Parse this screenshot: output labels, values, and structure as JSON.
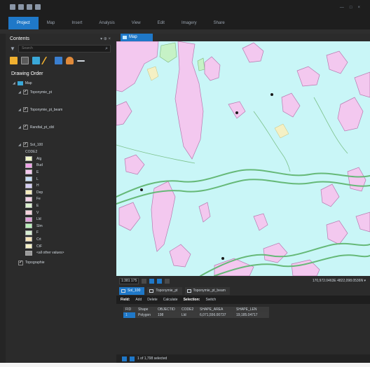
{
  "ribbon": {
    "tabs": [
      "Project",
      "Map",
      "Insert",
      "Analysis",
      "View",
      "Edit",
      "Imagery",
      "Share"
    ],
    "active_tab": "Project"
  },
  "contents": {
    "title": "Contents",
    "pane_controls": "▾ ⊕ ×",
    "search_placeholder": "Search",
    "drawing_order_label": "Drawing Order",
    "map_name": "Map",
    "layers": [
      {
        "name": "Toponymie_pt",
        "checked": true
      },
      {
        "name": "Toponymie_pt_beam",
        "checked": true
      },
      {
        "name": "Randtal_pt_cibl",
        "checked": true
      },
      {
        "name": "Sol_100",
        "checked": true
      }
    ],
    "legend_field": "CODE2",
    "legend": [
      {
        "label": "Alg",
        "color": "#f1f7c9"
      },
      {
        "label": "Bud",
        "color": "#f0a0e8"
      },
      {
        "label": "E",
        "color": "#f4c7ee"
      },
      {
        "label": "L",
        "color": "#c5def7"
      },
      {
        "label": "H",
        "color": "#d4cdf5"
      },
      {
        "label": "Dep",
        "color": "#f5ecbc"
      },
      {
        "label": "Fe",
        "color": "#f3cfe7"
      },
      {
        "label": "E",
        "color": "#dcf2ce"
      },
      {
        "label": "V",
        "color": "#f5d2dc"
      },
      {
        "label": "Lld",
        "color": "#e29fdd"
      },
      {
        "label": "Slm",
        "color": "#b9f1b9"
      },
      {
        "label": "F",
        "color": "#d7efd2"
      },
      {
        "label": "Crt",
        "color": "#f7e4b8"
      },
      {
        "label": "CtF",
        "color": "#f6f1c4"
      },
      {
        "label": "<all other values>",
        "color": "#9a9a9a"
      }
    ],
    "footer_layer": "Topographie"
  },
  "map_view": {
    "tab_label": "Map"
  },
  "map_status": {
    "scale": "1:381 175",
    "coordinates": "170,972.0463E 4822,098.0536N ▾"
  },
  "attribute_table": {
    "tabs": [
      "Sol_100",
      "Toponymie_pt",
      "Toponymie_pt_beam"
    ],
    "active_tab": "Sol_100",
    "toolbar": {
      "field_label": "Field:",
      "add": "Add",
      "delete": "Delete",
      "calculate": "Calculate",
      "selection_label": "Selection:",
      "switch": "Switch"
    },
    "columns": [
      "FID",
      "Shape",
      "OBJECTID",
      "CODE2",
      "SHAPE_AREA",
      "SHAPE_LEN"
    ],
    "rows": [
      [
        "1",
        "Polygon",
        "198",
        "Lld",
        "6,071,556.00737",
        "19,185.04717"
      ]
    ],
    "footer": "1 of 1,798 selected"
  },
  "colors": {
    "accent": "#1f78c8",
    "map_water": "#c9f6f7",
    "map_pink": "#f2c6ee",
    "map_green_line": "#66b978"
  }
}
